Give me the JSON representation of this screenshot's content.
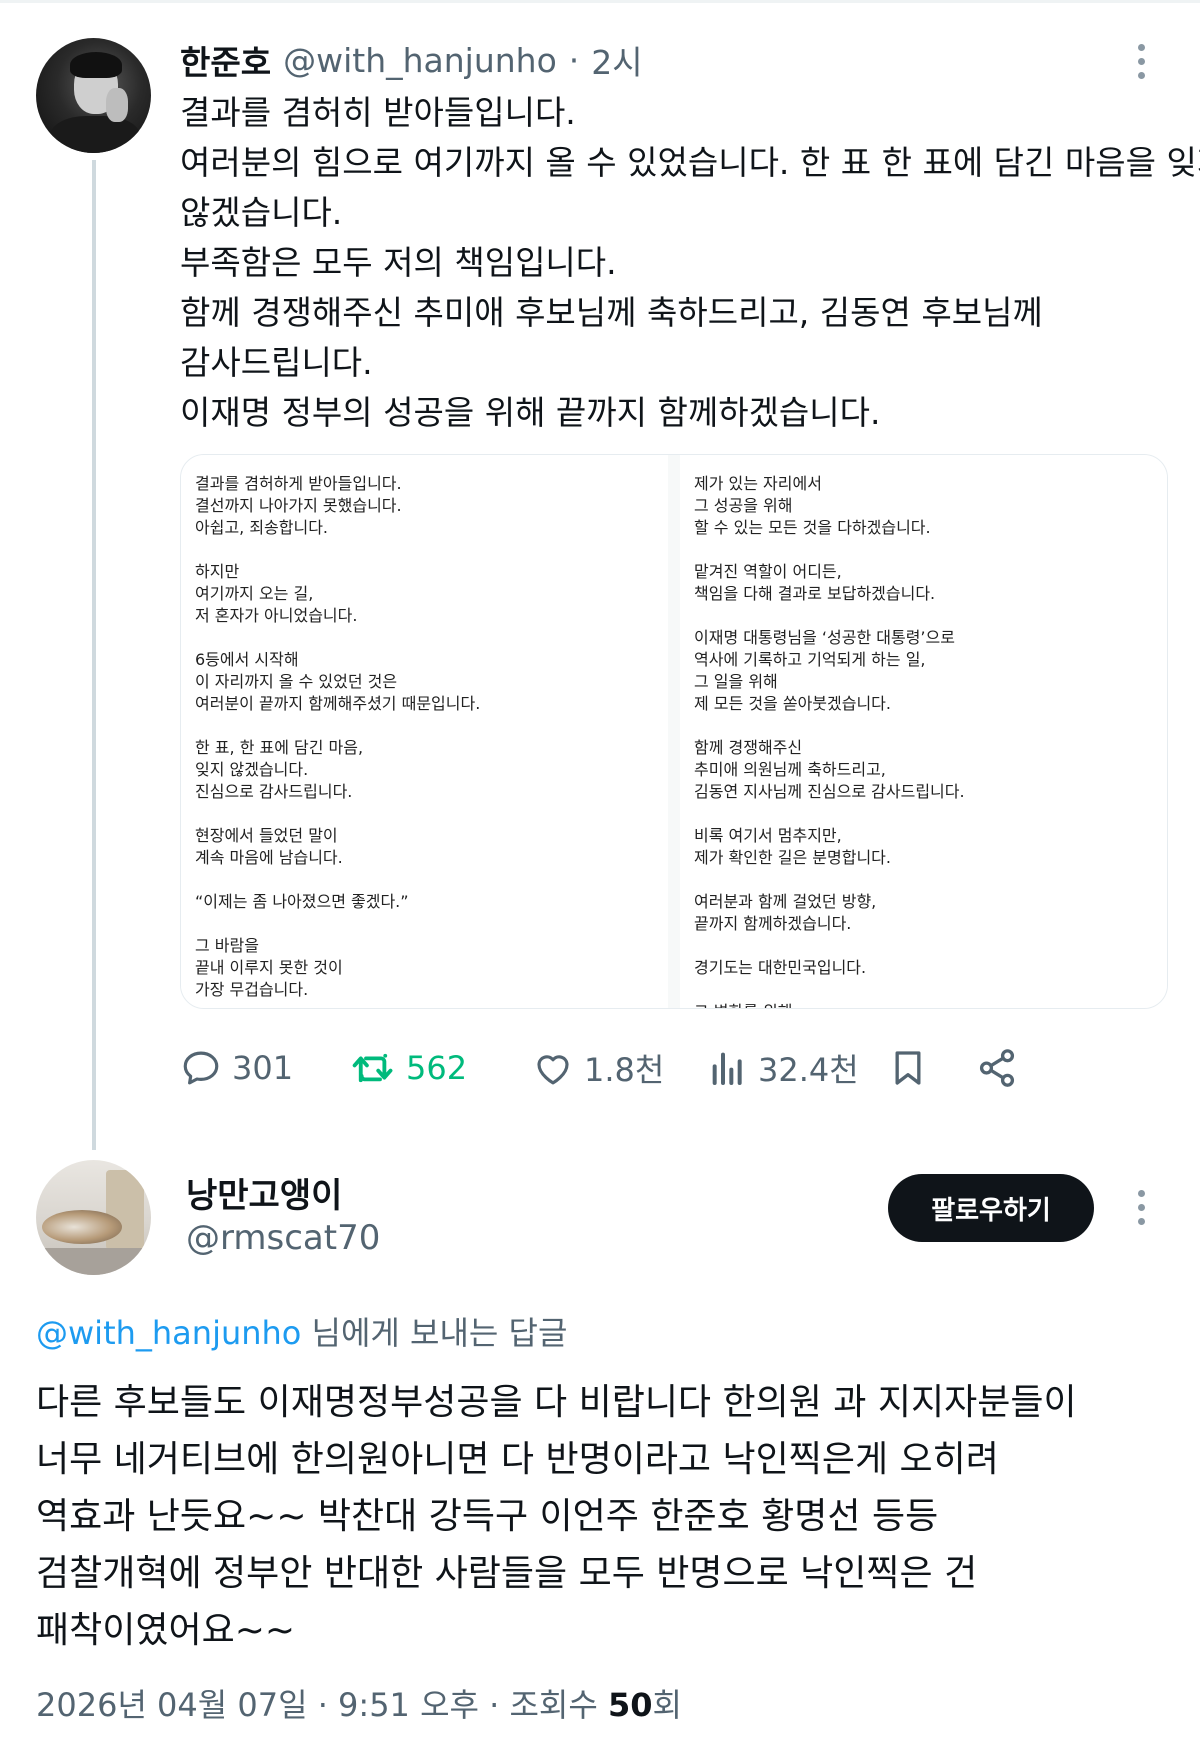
{
  "parent_tweet": {
    "author_name": "한준호",
    "author_handle": "@with_hanjunho",
    "separator": "·",
    "time": "2시",
    "text_lines": [
      "결과를 겸허히 받아들입니다.",
      "여러분의 힘으로 여기까지 올 수 있었습니다. 한 표 한 표에 담긴 마음을 잊지",
      "않겠습니다.",
      "부족함은 모두 저의 책임입니다.",
      "함께 경쟁해주신 추미애 후보님께 축하드리고, 김동연 후보님께",
      "감사드립니다.",
      "이재명 정부의 성공을 위해 끝까지 함께하겠습니다."
    ],
    "image_left_lines": [
      "결과를 겸허하게 받아들입니다.",
      "결선까지 나아가지 못했습니다.",
      "아쉽고, 죄송합니다.",
      "",
      "하지만",
      "여기까지 오는 길,",
      "저 혼자가 아니었습니다.",
      "",
      "6등에서 시작해",
      "이 자리까지 올 수 있었던 것은",
      "여러분이 끝까지 함께해주셨기 때문입니다.",
      "",
      "한 표, 한 표에 담긴 마음,",
      "잊지 않겠습니다.",
      "진심으로 감사드립니다.",
      "",
      "현장에서 들었던 말이",
      "계속 마음에 남습니다.",
      "",
      "“이제는 좀 나아졌으면 좋겠다.”",
      "",
      "그 바람을",
      "끝내 이루지 못한 것이",
      "가장 무겁습니다."
    ],
    "image_right_lines": [
      "제가 있는 자리에서",
      "그 성공을 위해",
      "할 수 있는 모든 것을 다하겠습니다.",
      "",
      "맡겨진 역할이 어디든,",
      "책임을 다해 결과로 보답하겠습니다.",
      "",
      "이재명 대통령님을 ‘성공한 대통령’으로",
      "역사에 기록하고 기억되게 하는 일,",
      "그 일을 위해",
      "제 모든 것을 쏟아붓겠습니다.",
      "",
      "함께 경쟁해주신",
      "추미애 의원님께 축하드리고,",
      "김동연 지사님께 진심으로 감사드립니다.",
      "",
      "비록 여기서 멈추지만,",
      "제가 확인한 길은 분명합니다.",
      "",
      "여러분과 함께 걸었던 방향,",
      "끝까지 함께하겠습니다.",
      "",
      "경기도는 대한민국입니다.",
      "",
      "그 변화를 위해"
    ],
    "actions": {
      "replies": "301",
      "retweets": "562",
      "likes": "1.8천",
      "views": "32.4천"
    }
  },
  "reply": {
    "author_name": "낭만고앵이",
    "author_handle": "@rmscat70",
    "follow_label": "팔로우하기",
    "replying_mention": "@with_hanjunho",
    "replying_suffix": " 님에게 보내는 답글",
    "text_lines": [
      "다른 후보들도  이재명정부성공을 다 비랍니다  한의원 과 지지자분들이",
      "너무 네거티브에  한의원아니면 다 반명이라고 낙인찍은게 오히려",
      "역효과 난듯요~~ 박찬대 강득구 이언주 한준호 황명선  등등",
      "검찰개혁에 정부안 반대한 사람들을 모두 반명으로 낙인찍은 건",
      "패착이였어요~~"
    ],
    "meta_date": "2026년 04월 07일 · 9:51 오후 · 조회수 ",
    "meta_views": "50",
    "meta_views_suffix": "회"
  },
  "colors": {
    "text": "#0f1419",
    "secondary": "#536471",
    "link": "#1d9bf0",
    "retweet": "#00ba7c",
    "button_bg": "#0f1419"
  },
  "icons": [
    "reply-icon",
    "retweet-icon",
    "like-icon",
    "views-icon",
    "bookmark-icon",
    "share-icon",
    "more-icon"
  ]
}
